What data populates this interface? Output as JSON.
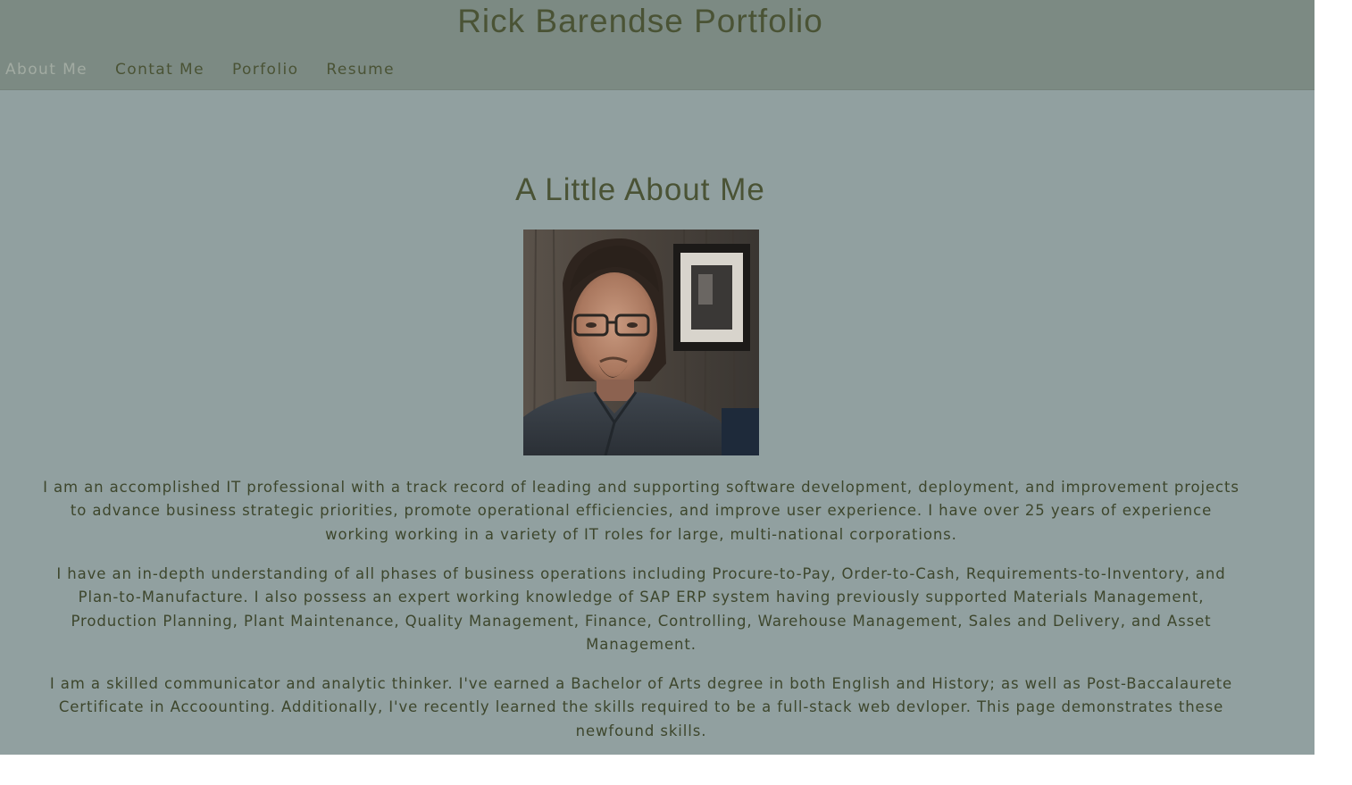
{
  "header": {
    "title": "Rick Barendse Portfolio",
    "nav": [
      {
        "label": "About Me",
        "active": true
      },
      {
        "label": "Contat Me",
        "active": false
      },
      {
        "label": "Porfolio",
        "active": false
      },
      {
        "label": "Resume",
        "active": false
      }
    ]
  },
  "about": {
    "heading": "A Little About Me",
    "paragraphs": [
      "I am an accomplished IT professional with a track record of leading and supporting software development, deployment, and improvement projects to advance business strategic priorities, promote operational efficiencies, and improve user experience. I have over 25 years of experience working working in a variety of IT roles for large, multi-national corporations.",
      "I have an in-depth understanding of all phases of business operations including Procure-to-Pay, Order-to-Cash, Requirements-to-Inventory, and Plan-to-Manufacture. I also possess an expert working knowledge of SAP ERP system having previously supported Materials Management, Production Planning, Plant Maintenance, Quality Management, Finance, Controlling, Warehouse Management, Sales and Delivery, and Asset Management.",
      "I am a skilled communicator and analytic thinker. I've earned a Bachelor of Arts degree in both English and History; as well as Post-Baccalaurete Certificate in Accoounting. Additionally, I've recently learned the skills required to be a full-stack web devloper. This page demonstrates these newfound skills."
    ]
  },
  "colors": {
    "header_bg": "#7c8a83",
    "page_bg": "#91a0a0",
    "text": "#4a5335",
    "nav_active": "#a2aba2"
  }
}
